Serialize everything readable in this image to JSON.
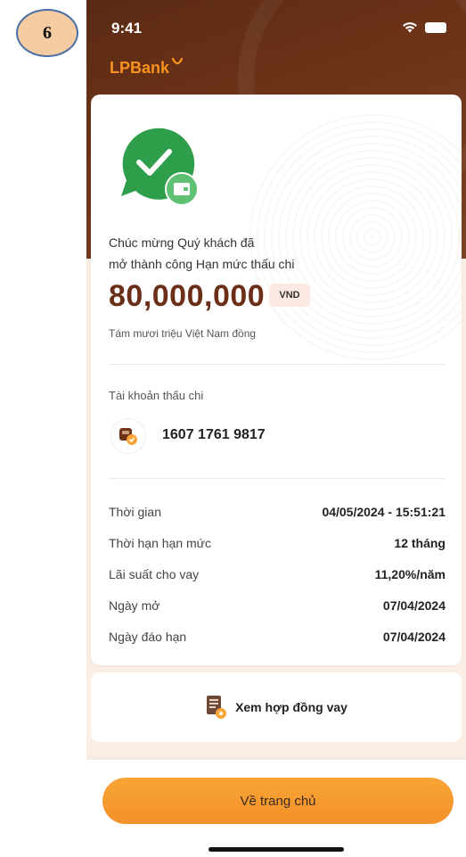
{
  "step_badge": "6",
  "status_bar": {
    "time": "9:41"
  },
  "brand": {
    "name": "LPBank"
  },
  "success": {
    "line1": "Chúc mừng Quý khách đã",
    "line2": "mở thành công Hạn mức thấu chi",
    "amount": "80,000,000",
    "currency": "VND",
    "amount_words": "Tám  mươi triệu Việt Nam đồng"
  },
  "account": {
    "label": "Tài khoản thấu chi",
    "number": "1607 1761 9817"
  },
  "details": [
    {
      "label": "Thời gian",
      "value": "04/05/2024 - 15:51:21"
    },
    {
      "label": "Thời hạn hạn mức",
      "value": "12 tháng"
    },
    {
      "label": "Lãi suất cho vay",
      "value": "11,20%/năm"
    },
    {
      "label": "Ngày mở",
      "value": "07/04/2024"
    },
    {
      "label": "Ngày đáo hạn",
      "value": "07/04/2024"
    }
  ],
  "contract": {
    "label": "Xem hợp đồng vay"
  },
  "footer": {
    "home_button": "Về trang chủ"
  },
  "colors": {
    "brand_orange": "#f7931e",
    "header_brown": "#5b2a14",
    "amount_brown": "#6b2e17",
    "success_green": "#2f9e4a"
  }
}
